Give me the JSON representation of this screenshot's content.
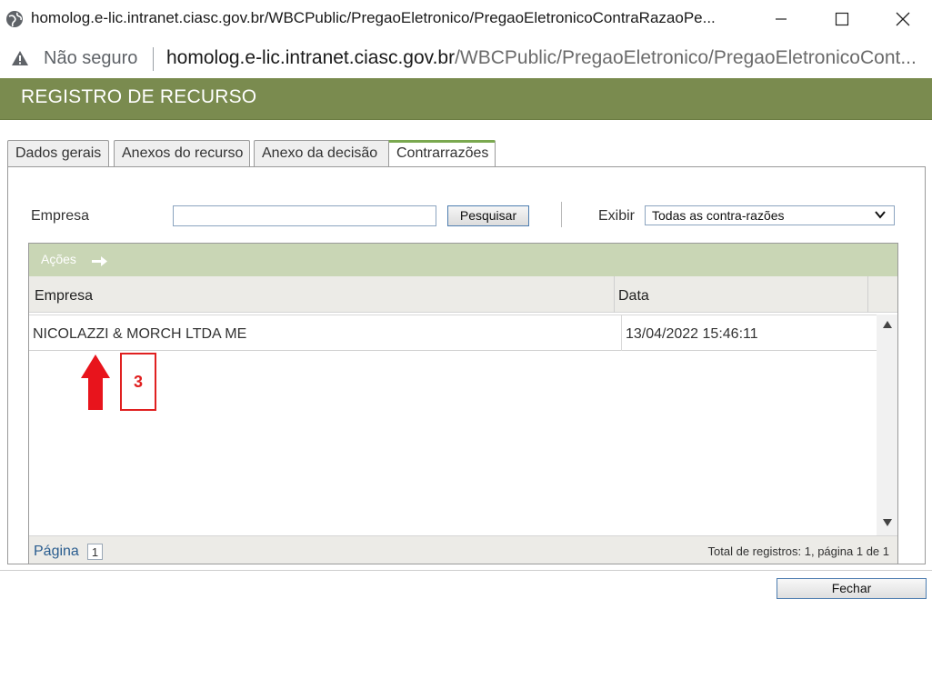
{
  "window": {
    "title": "homolog.e-lic.intranet.ciasc.gov.br/WBCPublic/PregaoEletronico/PregaoEletronicoContraRazaoPe...",
    "controls": [
      "minimize",
      "maximize",
      "close"
    ]
  },
  "address_bar": {
    "security_label": "Não seguro",
    "url_host": "homolog.e-lic.intranet.ciasc.gov.br",
    "url_path": "/WBCPublic/PregaoEletronico/PregaoEletronicoCont..."
  },
  "header": {
    "title": "REGISTRO DE RECURSO",
    "color": "#7a8b4f"
  },
  "tabs": [
    {
      "label": "Dados gerais",
      "active": false
    },
    {
      "label": "Anexos do recurso",
      "active": false
    },
    {
      "label": "Anexo da decisão",
      "active": false
    },
    {
      "label": "Contrarrazões",
      "active": true
    }
  ],
  "filters": {
    "empresa_label": "Empresa",
    "empresa_value": "",
    "search_button": "Pesquisar",
    "exibir_label": "Exibir",
    "exibir_selected": "Todas as contra-razões"
  },
  "grid": {
    "actions_label": "Ações",
    "columns": [
      "Empresa",
      "Data"
    ],
    "rows": [
      {
        "empresa": "NICOLAZZI & MORCH LTDA ME",
        "data": "13/04/2022 15:46:11"
      }
    ],
    "pagination_label": "Página",
    "current_page": "1",
    "total_text": "Total de registros: 1,  página  1  de  1"
  },
  "annotation": {
    "label": "3",
    "color": "#e02020"
  },
  "footer": {
    "close_button": "Fechar"
  }
}
